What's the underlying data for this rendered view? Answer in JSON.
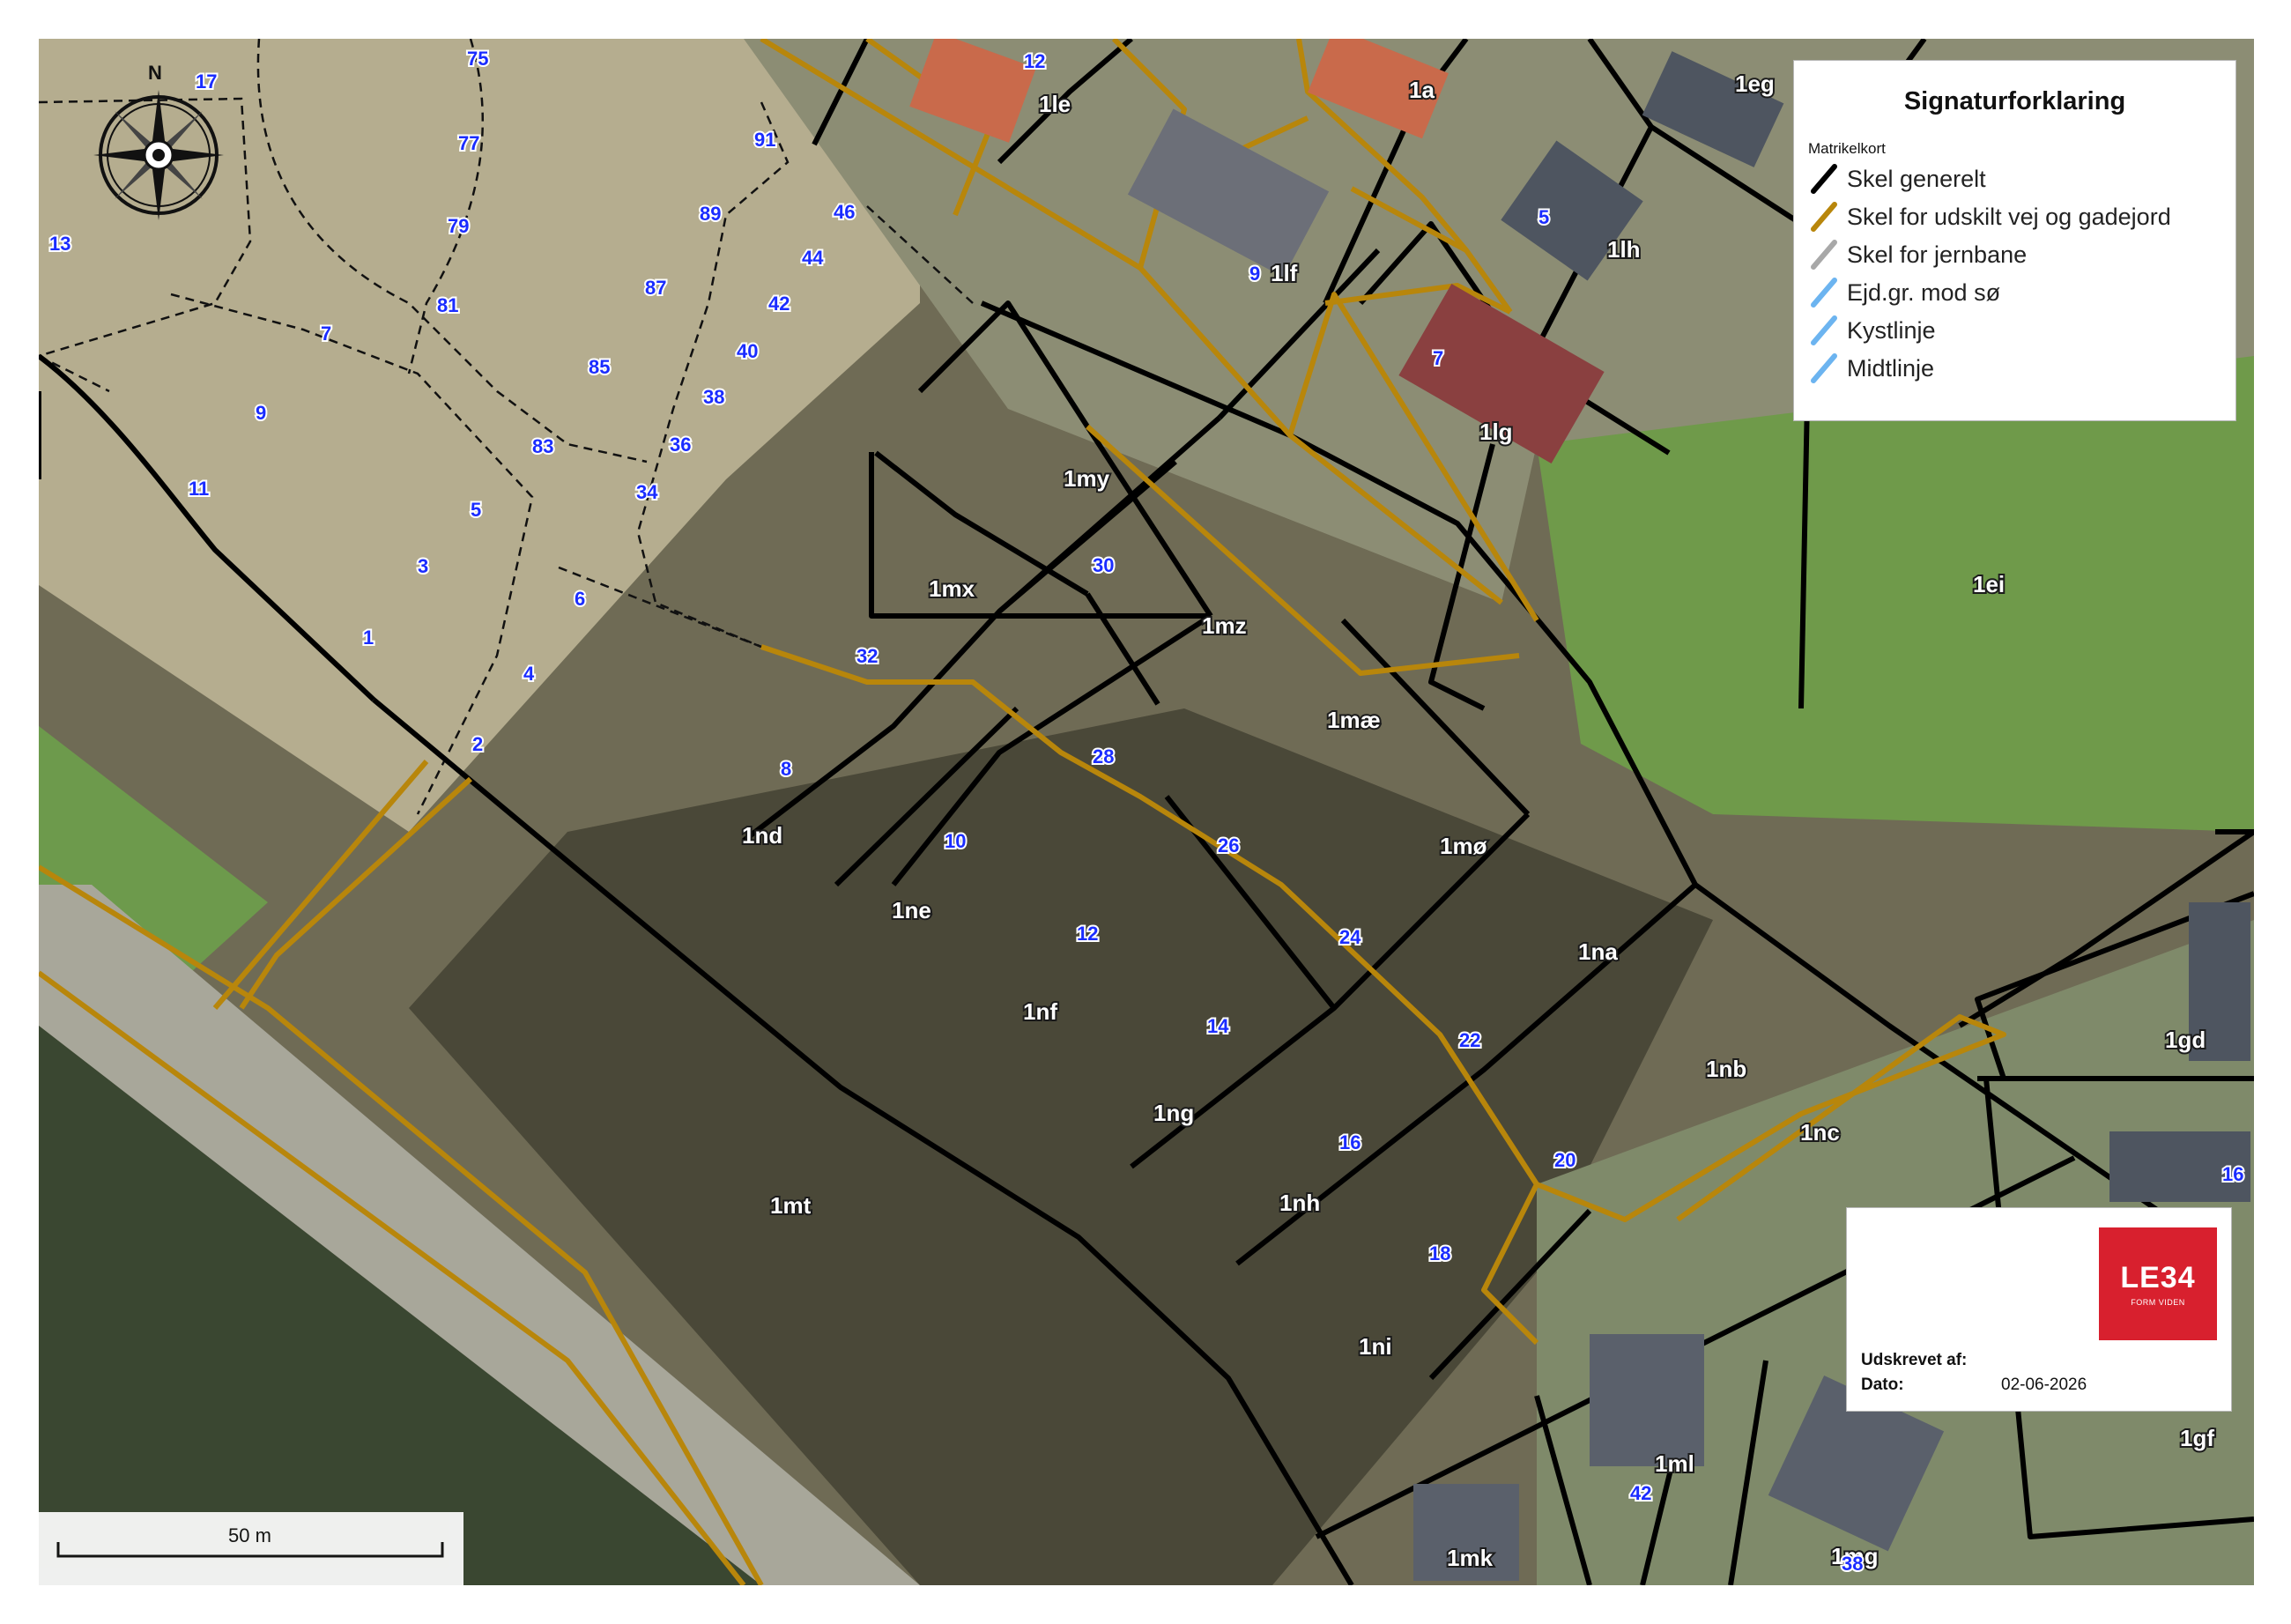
{
  "legend": {
    "title": "Signaturforklaring",
    "subtitle": "Matrikelkort",
    "items": [
      {
        "label": "Skel generelt",
        "color": "#000000"
      },
      {
        "label": "Skel for udskilt vej og gadejord",
        "color": "#b8860b"
      },
      {
        "label": "Skel for jernbane",
        "color": "#a8a8a8"
      },
      {
        "label": "Ejd.gr. mod sø",
        "color": "#6cb4f0"
      },
      {
        "label": "Kystlinje",
        "color": "#6cb4f0"
      },
      {
        "label": "Midtlinje",
        "color": "#6cb4f0"
      }
    ]
  },
  "scale": {
    "label": "50 m"
  },
  "compass": {
    "north": "N"
  },
  "print_info": {
    "printed_by_label": "Udskrevet af:",
    "date_label": "Dato:",
    "date_value": "02-06-2026",
    "logo_text": "LE34",
    "logo_sub": "FORM VIDEN"
  },
  "colors": {
    "boundary_general": "#000000",
    "boundary_road": "#b8860b",
    "house_number": "#1a2cff",
    "logo_bg": "#d8202e"
  },
  "parcels": [
    "1le",
    "1a",
    "1eg",
    "1lh",
    "1lf",
    "1lg",
    "1my",
    "1mx",
    "1mz",
    "1ei",
    "1mæ",
    "1mø",
    "1nd",
    "1ne",
    "1na",
    "1nf",
    "1nb",
    "1ng",
    "1nc",
    "1gd",
    "1mt",
    "1nh",
    "1ni",
    "1ml",
    "1mk",
    "1gf",
    "1mg"
  ],
  "house_numbers": [
    "17",
    "75",
    "77",
    "79",
    "91",
    "89",
    "46",
    "44",
    "42",
    "40",
    "38",
    "36",
    "34",
    "87",
    "85",
    "83",
    "81",
    "7",
    "9",
    "11",
    "5",
    "3",
    "1",
    "6",
    "4",
    "2",
    "13",
    "12",
    "5",
    "9",
    "7",
    "30",
    "32",
    "28",
    "26",
    "24",
    "22",
    "20",
    "18",
    "16",
    "14",
    "12",
    "10",
    "8",
    "16",
    "42",
    "38"
  ]
}
